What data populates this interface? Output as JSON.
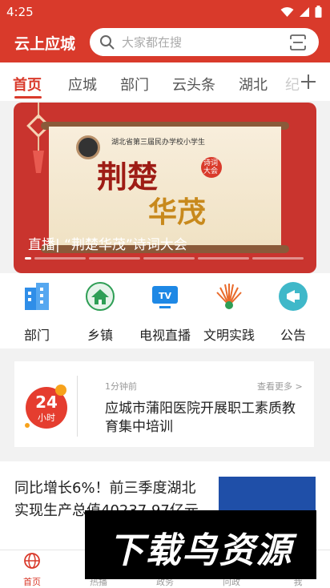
{
  "status_bar": {
    "time": "4:25"
  },
  "header": {
    "app_title": "云上应城",
    "search": {
      "placeholder": "大家都在搜"
    }
  },
  "tabs": [
    {
      "label": "首页",
      "active": true
    },
    {
      "label": "应城"
    },
    {
      "label": "部门"
    },
    {
      "label": "云头条"
    },
    {
      "label": "湖北"
    },
    {
      "label": "纪"
    }
  ],
  "banner": {
    "subtitle": "湖北省第三届民办学校小学生",
    "title_line1": "荆楚",
    "title_line2": "华茂",
    "seal_text": "诗词大会",
    "caption": "直播| “荆楚华茂”诗词大会"
  },
  "quick_links": [
    {
      "label": "部门",
      "icon": "building-icon",
      "color": "#2f8ee8"
    },
    {
      "label": "乡镇",
      "icon": "house-icon",
      "color": "#2e9e55"
    },
    {
      "label": "电视直播",
      "icon": "tv-icon",
      "color": "#1e88e5"
    },
    {
      "label": "文明实践",
      "icon": "sunburst-icon",
      "color": "#e96a2b"
    },
    {
      "label": "公告",
      "icon": "megaphone-icon",
      "color": "#3fb8c9"
    }
  ],
  "news24": {
    "badge_number": "24",
    "badge_label": "小时",
    "time": "1分钟前",
    "more": "查看更多 >",
    "title": "应城市蒲阳医院开展职工素质教育集中培训"
  },
  "article": {
    "title": "同比增长6%！前三季度湖北实现生产总值40237.97亿元"
  },
  "bottom_nav": [
    {
      "label": "首页",
      "active": true
    },
    {
      "label": "热播"
    },
    {
      "label": "政务"
    },
    {
      "label": "问政"
    },
    {
      "label": "我"
    }
  ],
  "watermark": {
    "text": "下载鸟资源"
  },
  "colors": {
    "brand_red": "#d93a2b"
  }
}
